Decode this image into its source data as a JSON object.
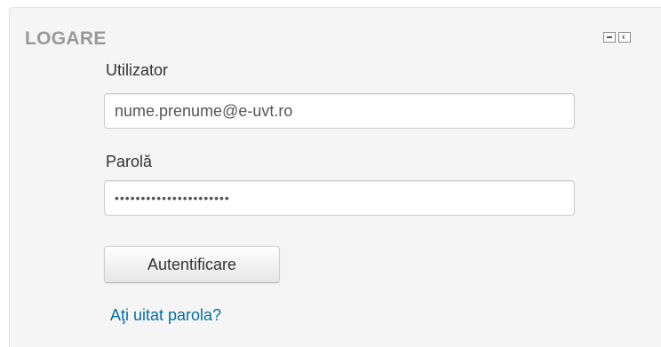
{
  "block": {
    "title": "LOGARE",
    "controls": {
      "minimize_icon": "minus-icon",
      "dock_icon": "chevron-left-icon",
      "dock_glyph": "‹"
    }
  },
  "login_form": {
    "username_label": "Utilizator",
    "username_value": "nume.prenume@e-uvt.ro",
    "password_label": "Parolă",
    "password_value": "••••••••••••••••••••••",
    "submit_label": "Autentificare",
    "forgot_password_link": "Aţi uitat parola?"
  },
  "colors": {
    "panel_background": "#f5f5f5",
    "title_color": "#999999",
    "link_color": "#0070a8"
  }
}
